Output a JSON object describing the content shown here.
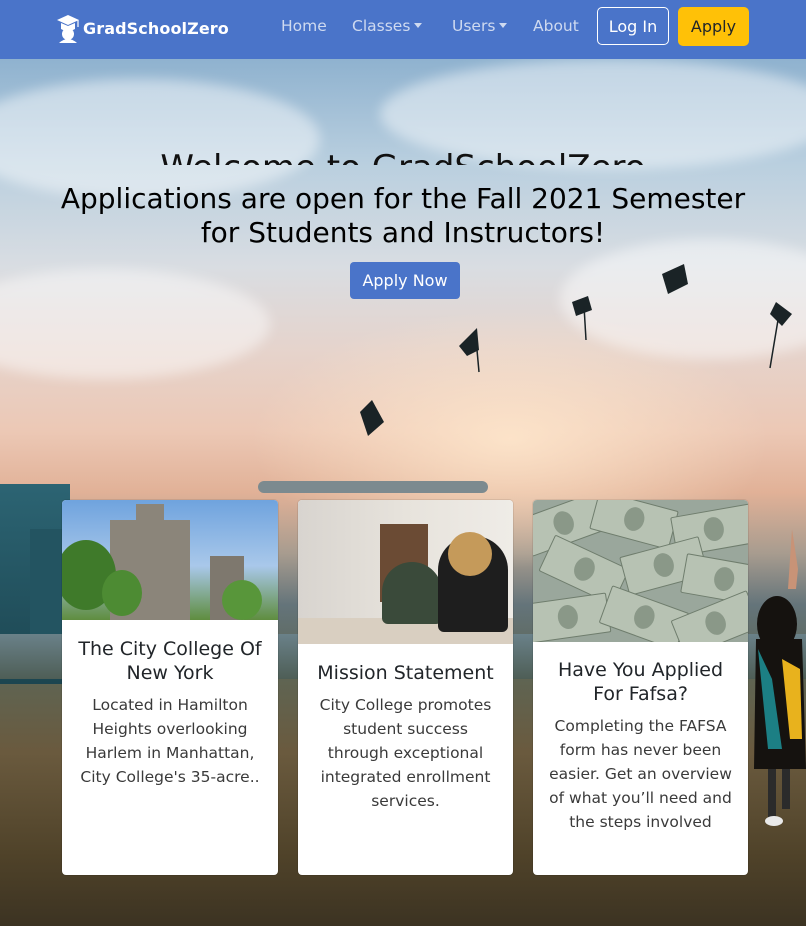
{
  "nav": {
    "brand": "GradSchoolZero",
    "links": [
      "Home",
      "Classes",
      "Users",
      "About"
    ],
    "login": "Log In",
    "apply": "Apply"
  },
  "hero": {
    "welcome": "Welcome to GradSchoolZero",
    "headline": "Applications are open for the Fall 2021 Semester for Students and Instructors!",
    "button": "Apply Now"
  },
  "cards": [
    {
      "title": "The City College Of New York",
      "text": "Located in Hamilton Heights overlooking Harlem in Manhattan, City College's 35-acre.."
    },
    {
      "title": "Mission Statement",
      "text": "City College promotes student success through exceptional integrated enrollment services."
    },
    {
      "title": "Have You Applied For Fafsa?",
      "text": "Completing the FAFSA form has never been easier. Get an overview of what you’ll need and the steps involved"
    }
  ],
  "colors": {
    "navbar": "#4a74c9",
    "apply_button": "#ffc107",
    "primary_button": "#4a74c9"
  },
  "icons": [
    "graduation-cap-logo-icon",
    "caret-down-icon"
  ]
}
